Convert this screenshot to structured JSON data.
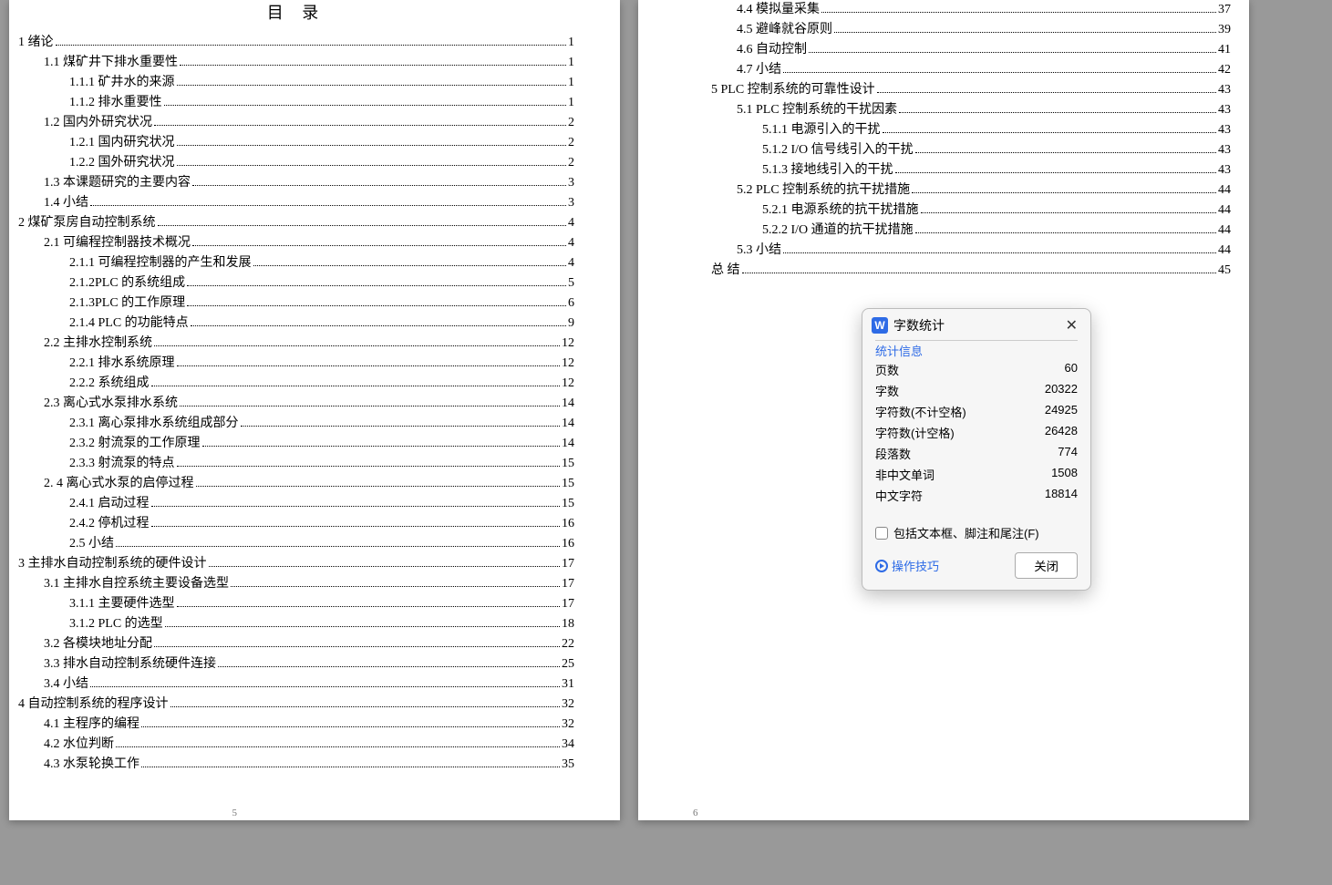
{
  "toc_title": "目 录",
  "page_footer_left": "5",
  "page_footer_right": "6",
  "left_entries": [
    {
      "level": 0,
      "text": "1 绪论",
      "page": "1"
    },
    {
      "level": 1,
      "text": "1.1 煤矿井下排水重要性",
      "page": "1"
    },
    {
      "level": 2,
      "text": "1.1.1 矿井水的来源",
      "page": "1"
    },
    {
      "level": 2,
      "text": "1.1.2 排水重要性",
      "page": "1"
    },
    {
      "level": 1,
      "text": "1.2 国内外研究状况",
      "page": "2"
    },
    {
      "level": 2,
      "text": "1.2.1 国内研究状况",
      "page": "2"
    },
    {
      "level": 2,
      "text": "1.2.2 国外研究状况",
      "page": "2"
    },
    {
      "level": 1,
      "text": "1.3 本课题研究的主要内容",
      "page": "3"
    },
    {
      "level": 1,
      "text": "1.4 小结",
      "page": "3"
    },
    {
      "level": 0,
      "text": "2 煤矿泵房自动控制系统",
      "page": "4"
    },
    {
      "level": 1,
      "text": "2.1  可编程控制器技术概况",
      "page": "4"
    },
    {
      "level": 2,
      "text": "2.1.1  可编程控制器的产生和发展",
      "page": "4"
    },
    {
      "level": 2,
      "text": "2.1.2PLC 的系统组成",
      "page": "5"
    },
    {
      "level": 2,
      "text": "2.1.3PLC 的工作原理",
      "page": "6"
    },
    {
      "level": 2,
      "text": "2.1.4  PLC 的功能特点",
      "page": "9"
    },
    {
      "level": 1,
      "text": "2.2 主排水控制系统",
      "page": "12"
    },
    {
      "level": 2,
      "text": "2.2.1 排水系统原理",
      "page": "12"
    },
    {
      "level": 2,
      "text": "2.2.2 系统组成",
      "page": "12"
    },
    {
      "level": 1,
      "text": "2.3 离心式水泵排水系统",
      "page": "14"
    },
    {
      "level": 2,
      "text": "2.3.1 离心泵排水系统组成部分",
      "page": "14"
    },
    {
      "level": 2,
      "text": "2.3.2  射流泵的工作原理",
      "page": "14"
    },
    {
      "level": 2,
      "text": "2.3.3 射流泵的特点",
      "page": "15"
    },
    {
      "level": 1,
      "text": "2. 4 离心式水泵的启停过程",
      "page": "15"
    },
    {
      "level": 2,
      "text": "2.4.1 启动过程",
      "page": "15"
    },
    {
      "level": 2,
      "text": "2.4.2 停机过程",
      "page": "16"
    },
    {
      "level": 2,
      "text": "2.5 小结",
      "page": "16"
    },
    {
      "level": 0,
      "text": "3 主排水自动控制系统的硬件设计",
      "page": "17"
    },
    {
      "level": 1,
      "text": "3.1 主排水自控系统主要设备选型",
      "page": "17"
    },
    {
      "level": 2,
      "text": "3.1.1 主要硬件选型",
      "page": "17"
    },
    {
      "level": 2,
      "text": "3.1.2 PLC 的选型",
      "page": "18"
    },
    {
      "level": 1,
      "text": "3.2 各模块地址分配",
      "page": "22"
    },
    {
      "level": 1,
      "text": "3.3 排水自动控制系统硬件连接",
      "page": "25"
    },
    {
      "level": 1,
      "text": "3.4 小结",
      "page": "31"
    },
    {
      "level": 0,
      "text": "4 自动控制系统的程序设计",
      "page": "32"
    },
    {
      "level": 1,
      "text": "4.1 主程序的编程",
      "page": "32"
    },
    {
      "level": 1,
      "text": "4.2 水位判断",
      "page": "34"
    },
    {
      "level": 1,
      "text": "4.3 水泵轮换工作",
      "page": "35"
    }
  ],
  "right_entries": [
    {
      "level": 1,
      "text": "4.4 模拟量采集",
      "page": "37"
    },
    {
      "level": 1,
      "text": "4.5 避峰就谷原则",
      "page": "39"
    },
    {
      "level": 1,
      "text": "4.6 自动控制",
      "page": "41"
    },
    {
      "level": 1,
      "text": "4.7 小结",
      "page": "42"
    },
    {
      "level": 0,
      "text": "5   PLC 控制系统的可靠性设计",
      "page": "43"
    },
    {
      "level": 1,
      "text": "5.1 PLC 控制系统的干扰因素",
      "page": "43"
    },
    {
      "level": 2,
      "text": "5.1.1 电源引入的干扰",
      "page": "43"
    },
    {
      "level": 2,
      "text": "5.1.2 I/O 信号线引入的干扰",
      "page": "43"
    },
    {
      "level": 2,
      "text": "5.1.3 接地线引入的干扰",
      "page": "43"
    },
    {
      "level": 1,
      "text": "5.2 PLC 控制系统的抗干扰措施",
      "page": "44"
    },
    {
      "level": 2,
      "text": "5.2.1 电源系统的抗干扰措施",
      "page": "44"
    },
    {
      "level": 2,
      "text": "5.2.2 I/O 通道的抗干扰措施",
      "page": "44"
    },
    {
      "level": 1,
      "text": "5.3 小结",
      "page": "44"
    },
    {
      "level": 0,
      "text": "总  结",
      "page": "45"
    }
  ],
  "dialog": {
    "icon_letter": "W",
    "title": "字数统计",
    "section_title": "统计信息",
    "stats": [
      {
        "label": "页数",
        "value": "60"
      },
      {
        "label": "字数",
        "value": "20322"
      },
      {
        "label": "字符数(不计空格)",
        "value": "24925"
      },
      {
        "label": "字符数(计空格)",
        "value": "26428"
      },
      {
        "label": "段落数",
        "value": "774"
      },
      {
        "label": "非中文单词",
        "value": "1508"
      },
      {
        "label": "中文字符",
        "value": "18814"
      }
    ],
    "checkbox_label": "包括文本框、脚注和尾注(F)",
    "tips_label": "操作技巧",
    "close_button": "关闭"
  }
}
